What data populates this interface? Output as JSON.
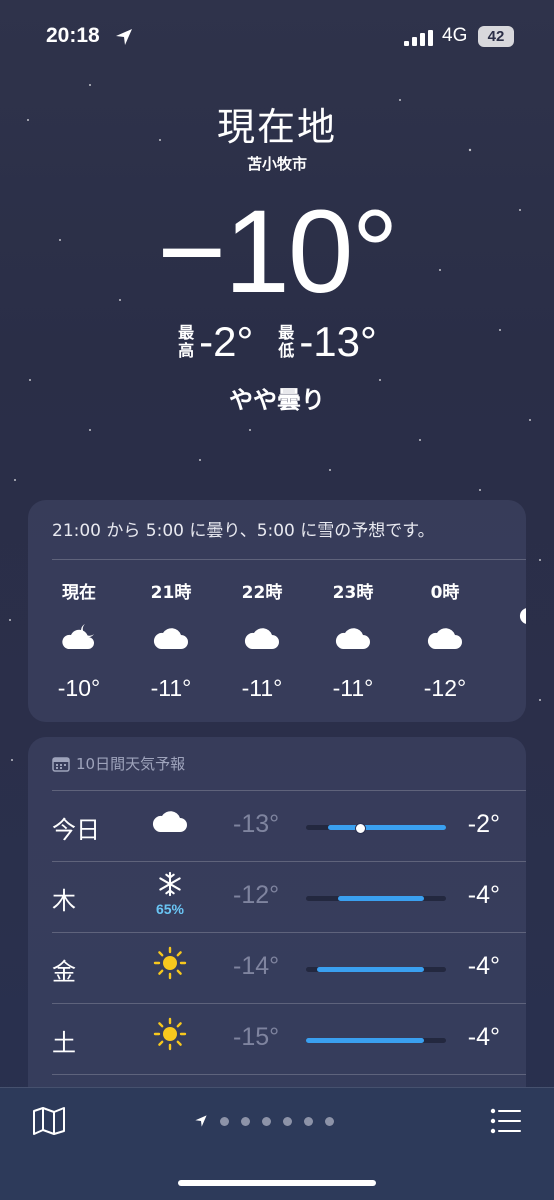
{
  "status_bar": {
    "time": "20:18",
    "network": "4G",
    "battery": "42"
  },
  "location": {
    "title": "現在地",
    "city": "苫小牧市"
  },
  "current": {
    "temp": "−10°",
    "high_label": "最高",
    "high": "-2°",
    "low_label": "最低",
    "low": "-13°",
    "condition": "やや曇り"
  },
  "hourly": {
    "summary": "21:00 から 5:00 に曇り、5:00 に雪の予想です。",
    "items": [
      {
        "label": "現在",
        "icon": "partly-cloudy-night-icon",
        "temp": "-10°"
      },
      {
        "label": "21時",
        "icon": "cloud-icon",
        "temp": "-11°"
      },
      {
        "label": "22時",
        "icon": "cloud-icon",
        "temp": "-11°"
      },
      {
        "label": "23時",
        "icon": "cloud-icon",
        "temp": "-11°"
      },
      {
        "label": "0時",
        "icon": "cloud-icon",
        "temp": "-12°"
      },
      {
        "label": "",
        "icon": "cloud-icon",
        "temp": "-"
      }
    ]
  },
  "daily": {
    "header": "10日間天気予報",
    "range_min": -15,
    "range_max": -2,
    "rows": [
      {
        "day": "今日",
        "icon": "cloud-icon",
        "pop": "",
        "low": "-13°",
        "high": "-2°",
        "low_val": -13,
        "high_val": -2,
        "current_val": -10,
        "show_current": true
      },
      {
        "day": "木",
        "icon": "snowflake-icon",
        "pop": "65%",
        "low": "-12°",
        "high": "-4°",
        "low_val": -12,
        "high_val": -4,
        "show_current": false
      },
      {
        "day": "金",
        "icon": "sun-icon",
        "pop": "",
        "low": "-14°",
        "high": "-4°",
        "low_val": -14,
        "high_val": -4,
        "show_current": false
      },
      {
        "day": "土",
        "icon": "sun-icon",
        "pop": "",
        "low": "-15°",
        "high": "-4°",
        "low_val": -15,
        "high_val": -4,
        "show_current": false
      }
    ]
  },
  "pager": {
    "pages": 6,
    "current": 0
  }
}
